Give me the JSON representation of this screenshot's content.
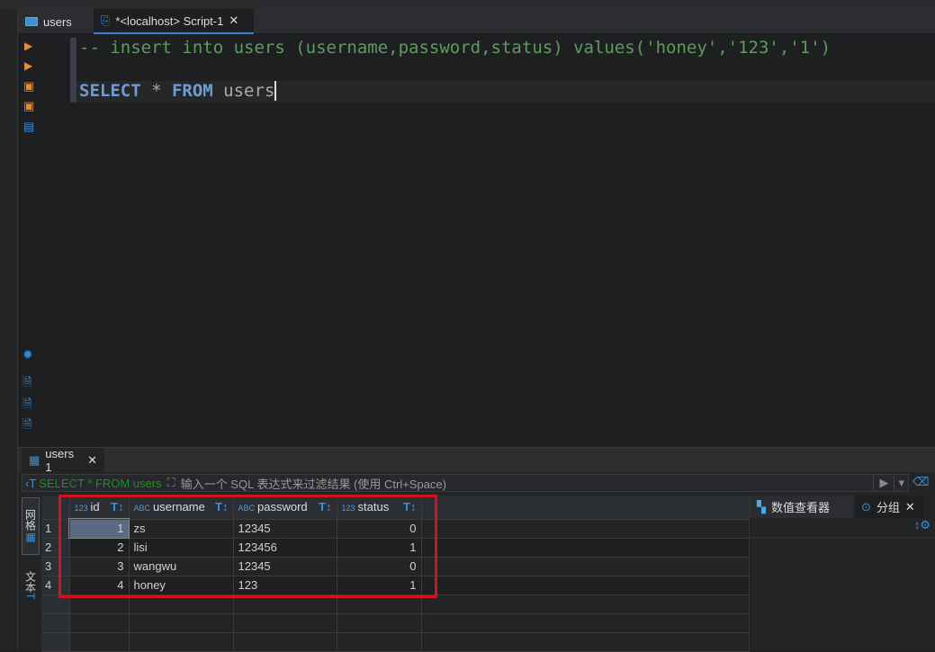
{
  "tabs": [
    {
      "label": "users",
      "icon": "table-icon"
    },
    {
      "label": "*<localhost> Script-1",
      "icon": "script-icon",
      "active": true
    }
  ],
  "editor": {
    "line1": "-- insert into users (username,password,status) values('honey','123','1')",
    "line3_kw1": "SELECT",
    "line3_star": " * ",
    "line3_kw2": "FROM",
    "line3_ident": " users"
  },
  "results": {
    "tab_label": "users 1",
    "filter_query": "SELECT * FROM users",
    "filter_placeholder": "输入一个 SQL 表达式来过滤结果 (使用 Ctrl+Space)",
    "vertical_tabs": [
      "网格",
      "文本"
    ],
    "columns": [
      {
        "type": "123",
        "name": "id"
      },
      {
        "type": "ABC",
        "name": "username"
      },
      {
        "type": "ABC",
        "name": "password"
      },
      {
        "type": "123",
        "name": "status"
      }
    ],
    "rows": [
      [
        "1",
        "1",
        "zs",
        "12345",
        "0"
      ],
      [
        "2",
        "2",
        "lisi",
        "123456",
        "1"
      ],
      [
        "3",
        "3",
        "wangwu",
        "12345",
        "0"
      ],
      [
        "4",
        "4",
        "honey",
        "123",
        "1"
      ]
    ],
    "right_tabs": [
      "数值查看器",
      "分组"
    ]
  },
  "colors": {
    "accent": "#3d7fd1",
    "comment": "#5f9b5f",
    "keyword": "#6f9bd6",
    "highlight": "#d0141b"
  }
}
